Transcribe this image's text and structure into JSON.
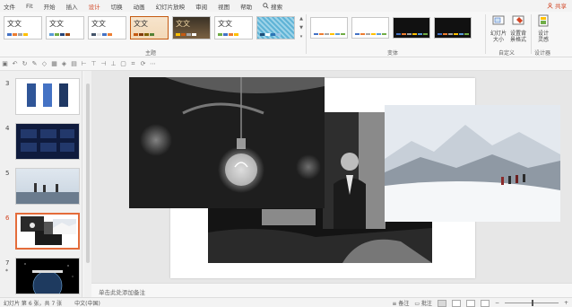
{
  "menu": {
    "items": [
      "文件",
      "Fit",
      "开始",
      "插入",
      "设计",
      "切换",
      "动画",
      "幻灯片放映",
      "审阅",
      "视图",
      "帮助"
    ],
    "search_label": "搜索",
    "share_label": "共享"
  },
  "ribbon": {
    "themes_label": "主题",
    "variants_label": "变体",
    "customize_label": "自定义",
    "designer_label": "设计器",
    "theme_text": "文文",
    "theme_names": [
      "文文"
    ],
    "slide_size_label": "幻灯片大小",
    "slide_size_lines": [
      "幻灯片",
      "大小"
    ],
    "bg_format_lines": [
      "设置背",
      "景格式"
    ],
    "design_ideas_lines": [
      "设计",
      "灵感"
    ],
    "accent_colors": [
      "#4472c4",
      "#ed7d31",
      "#a5a5a5",
      "#ffc000",
      "#5b9bd5",
      "#70ad47"
    ]
  },
  "thumbnails": [
    {
      "num": "3",
      "star": ""
    },
    {
      "num": "4",
      "star": ""
    },
    {
      "num": "5",
      "star": ""
    },
    {
      "num": "6",
      "star": "",
      "selected": true
    },
    {
      "num": "7",
      "star": "*"
    }
  ],
  "notes_placeholder": "单击此处添加备注",
  "status": {
    "slide_info": "幻灯片 第 6 张，共 7 张",
    "language": "中文(中国)",
    "notes_label": "备注",
    "comments_label": "批注"
  },
  "colors": {
    "accent": "#d24726",
    "selection": "#e46c3a"
  }
}
